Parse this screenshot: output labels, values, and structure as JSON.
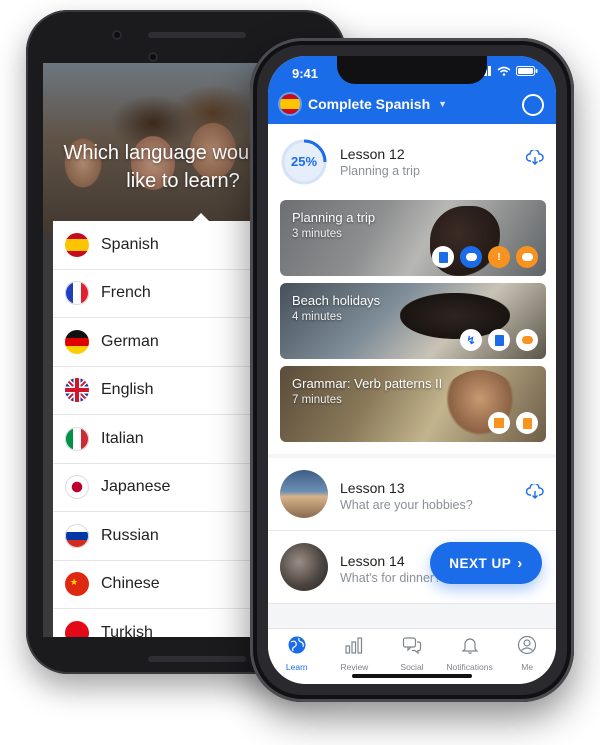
{
  "back_phone": {
    "question": "Which language would you like to learn?",
    "languages": [
      {
        "name": "Spanish",
        "flag": "spain-flag-icon"
      },
      {
        "name": "French",
        "flag": "france-flag-icon"
      },
      {
        "name": "German",
        "flag": "germany-flag-icon"
      },
      {
        "name": "English",
        "flag": "uk-flag-icon"
      },
      {
        "name": "Italian",
        "flag": "italy-flag-icon"
      },
      {
        "name": "Japanese",
        "flag": "japan-flag-icon"
      },
      {
        "name": "Russian",
        "flag": "russia-flag-icon"
      },
      {
        "name": "Chinese",
        "flag": "china-flag-icon"
      },
      {
        "name": "Turkish",
        "flag": "turkey-flag-icon"
      }
    ]
  },
  "front_phone": {
    "status_time": "9:41",
    "course_title": "Complete Spanish",
    "accent_color": "#1a6ce8",
    "lesson12": {
      "progress_label": "25%",
      "progress": 0.25,
      "title": "Lesson 12",
      "subtitle": "Planning a trip"
    },
    "activities": [
      {
        "title": "Planning a trip",
        "duration": "3 minutes"
      },
      {
        "title": "Beach holidays",
        "duration": "4 minutes"
      },
      {
        "title": "Grammar: Verb patterns II",
        "duration": "7 minutes"
      }
    ],
    "lesson13": {
      "title": "Lesson 13",
      "subtitle": "What are your hobbies?"
    },
    "lesson14": {
      "title": "Lesson 14",
      "subtitle": "What's for dinner?"
    },
    "next_button": "NEXT UP",
    "tabs": [
      {
        "label": "Learn",
        "icon": "globe-icon"
      },
      {
        "label": "Review",
        "icon": "chart-icon"
      },
      {
        "label": "Social",
        "icon": "chat-icon"
      },
      {
        "label": "Notifications",
        "icon": "bell-icon"
      },
      {
        "label": "Me",
        "icon": "user-icon"
      }
    ]
  }
}
